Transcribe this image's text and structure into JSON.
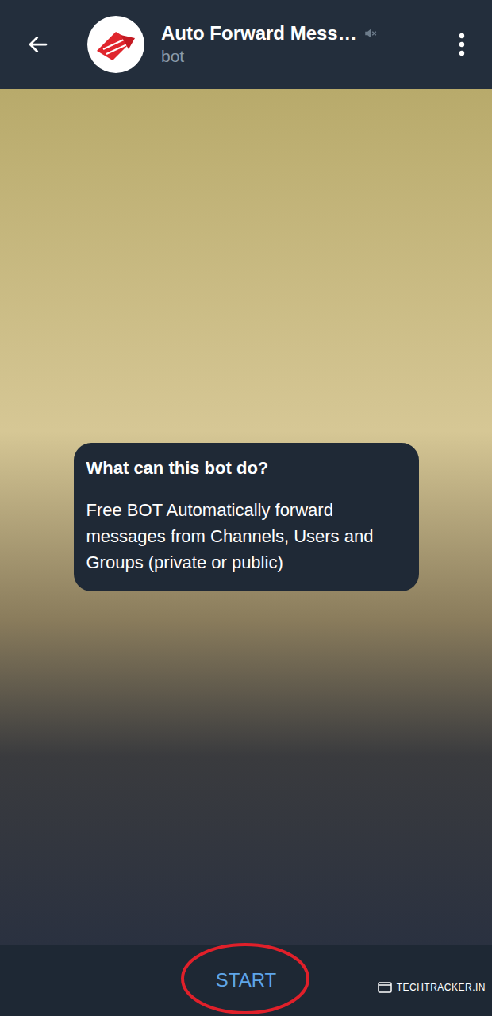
{
  "header": {
    "title": "Auto Forward Mess…",
    "subtitle": "bot",
    "muted": true
  },
  "info_card": {
    "title": "What can this bot do?",
    "body": "Free BOT Automatically forward messages from Channels, Users and Groups (private or public)"
  },
  "start_button": {
    "label": "START"
  },
  "watermark": {
    "text": "TECHTRACKER.IN"
  }
}
